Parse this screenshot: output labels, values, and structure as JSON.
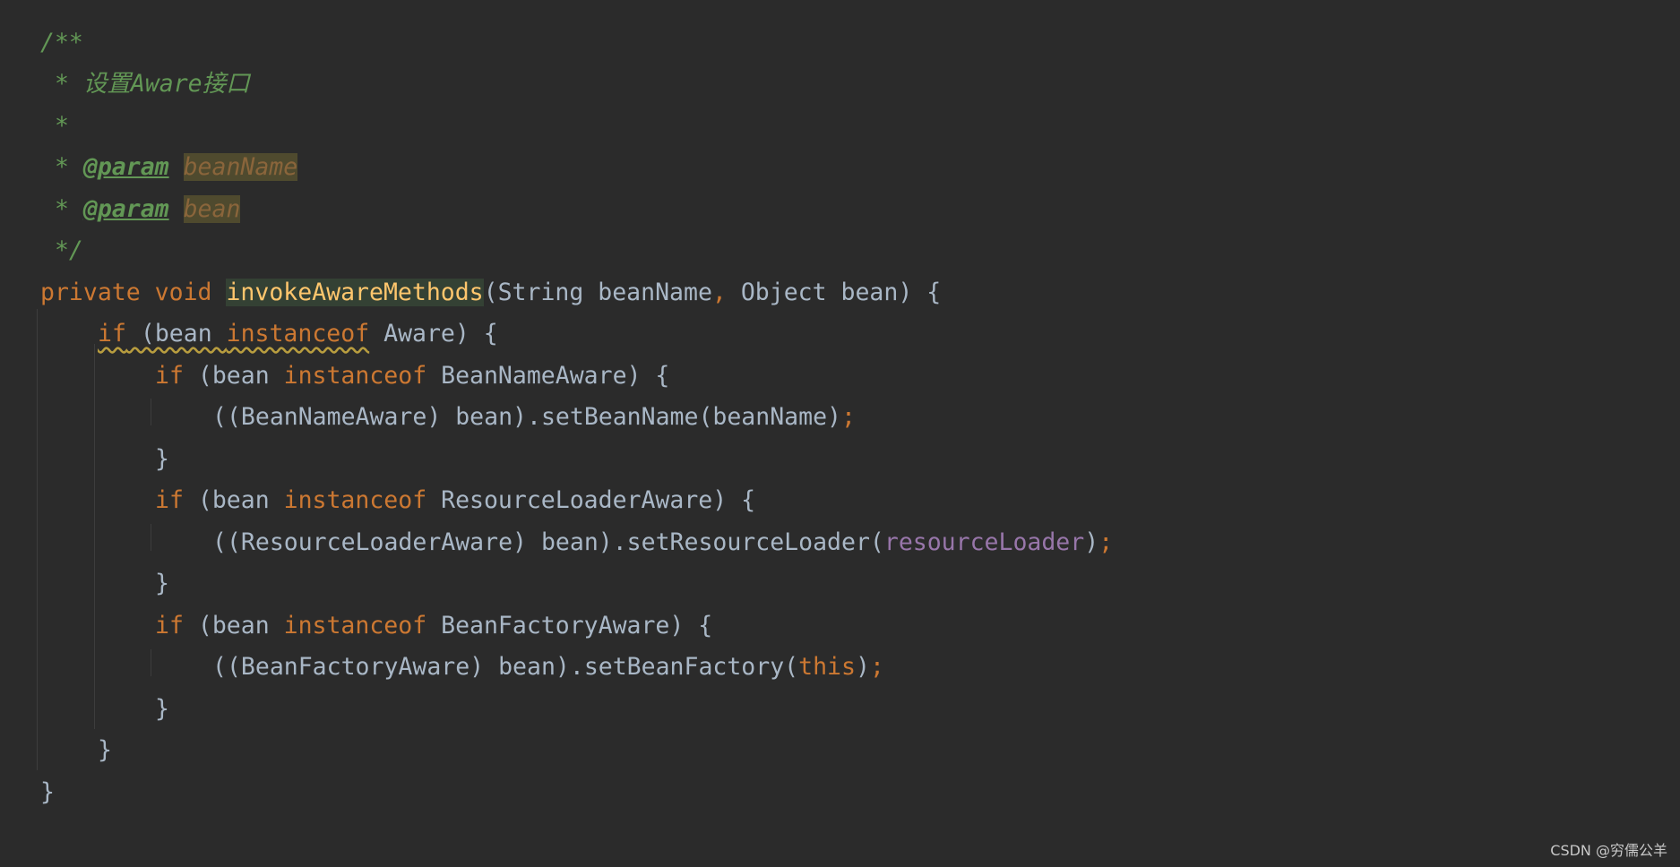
{
  "code": {
    "doc_open": "/**",
    "doc_desc": " * 设置Aware接口",
    "doc_blank": " *",
    "doc_star": " * ",
    "param_tag": "@param",
    "param1": "beanName",
    "param2": "bean",
    "doc_close": " */",
    "kw_private": "private",
    "kw_void": "void",
    "method_name": "invokeAwareMethods",
    "sig_open": "(String beanName",
    "sig_comma": ",",
    "sig_rest": " Object bean) {",
    "kw_if": "if",
    "kw_instanceof": "instanceof",
    "if_open": " (bean ",
    "aware_rest": " Aware) {",
    "bna_rest": " BeanNameAware) {",
    "bna_call": "((BeanNameAware) bean).setBeanName(beanName)",
    "rla_rest": " ResourceLoaderAware) {",
    "rla_call": "((ResourceLoaderAware) bean).setResourceLoader(",
    "rla_field": "resourceLoader",
    "close_paren": ")",
    "bfa_rest": " BeanFactoryAware) {",
    "bfa_call": "((BeanFactoryAware) bean).setBeanFactory(",
    "kw_this": "this",
    "semicolon": ";",
    "close_brace": "}"
  },
  "watermark": "CSDN @穷儒公羊"
}
